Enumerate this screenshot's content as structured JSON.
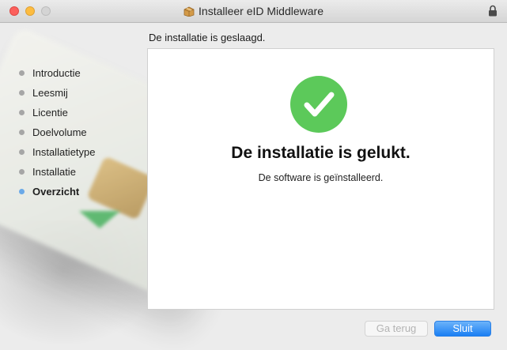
{
  "window": {
    "title": "Installeer eID Middleware",
    "title_icon": "package-icon",
    "lock_icon": "lock-icon"
  },
  "sidebar": {
    "steps": [
      {
        "label": "Introductie",
        "active": false
      },
      {
        "label": "Leesmij",
        "active": false
      },
      {
        "label": "Licentie",
        "active": false
      },
      {
        "label": "Doelvolume",
        "active": false
      },
      {
        "label": "Installatietype",
        "active": false
      },
      {
        "label": "Installatie",
        "active": false
      },
      {
        "label": "Overzicht",
        "active": true
      }
    ]
  },
  "main": {
    "heading": "De installatie is geslaagd.",
    "success_icon": "checkmark-icon",
    "title": "De installatie is gelukt.",
    "subtitle": "De software is geïnstalleerd."
  },
  "buttons": {
    "back_label": "Ga terug",
    "close_label": "Sluit"
  },
  "colors": {
    "success_green": "#5cc95a",
    "accent_blue": "#1b7ff3",
    "active_step_dot": "#6aa9e8"
  }
}
